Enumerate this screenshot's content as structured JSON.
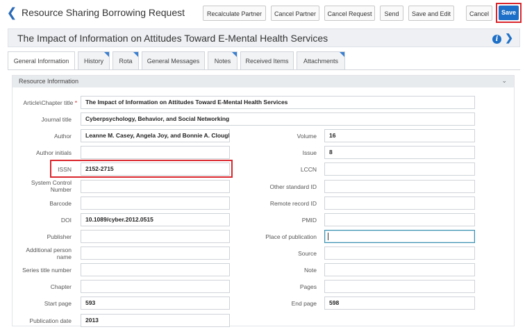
{
  "header": {
    "title": "Resource Sharing Borrowing Request",
    "buttons": [
      "Recalculate Partner",
      "Cancel Partner",
      "Cancel Request",
      "Send",
      "Save and Edit",
      "Cancel"
    ],
    "save_label": "Save"
  },
  "record": {
    "title": "The Impact of Information on Attitudes Toward E-Mental Health Services",
    "info": "i"
  },
  "tabs": [
    "General Information",
    "History",
    "Rota",
    "General Messages",
    "Notes",
    "Received Items",
    "Attachments"
  ],
  "section": {
    "title": "Resource Information"
  },
  "fields": {
    "article_title": {
      "label": "Article\\Chapter title",
      "req": "*",
      "value": "The Impact of Information on Attitudes Toward E-Mental Health Services"
    },
    "journal_title": {
      "label": "Journal title",
      "value": "Cyberpsychology, Behavior, and Social Networking"
    },
    "author": {
      "label": "Author",
      "value": "Leanne M. Casey, Angela Joy, and Bonnie A. Clough"
    },
    "author_initials": {
      "label": "Author initials",
      "value": ""
    },
    "issn": {
      "label": "ISSN",
      "value": "2152-2715"
    },
    "system_control_number": {
      "label": "System Control Number",
      "value": ""
    },
    "barcode": {
      "label": "Barcode",
      "value": ""
    },
    "doi": {
      "label": "DOI",
      "value": "10.1089/cyber.2012.0515"
    },
    "publisher": {
      "label": "Publisher",
      "value": ""
    },
    "additional_person_name": {
      "label": "Additional person name",
      "value": ""
    },
    "series_title_number": {
      "label": "Series title number",
      "value": ""
    },
    "chapter": {
      "label": "Chapter",
      "value": ""
    },
    "start_page": {
      "label": "Start page",
      "value": "593"
    },
    "publication_date": {
      "label": "Publication date",
      "value": "2013"
    },
    "volume": {
      "label": "Volume",
      "value": "16"
    },
    "issue": {
      "label": "Issue",
      "value": "8"
    },
    "lccn": {
      "label": "LCCN",
      "value": ""
    },
    "other_standard_id": {
      "label": "Other standard ID",
      "value": ""
    },
    "remote_record_id": {
      "label": "Remote record ID",
      "value": ""
    },
    "pmid": {
      "label": "PMID",
      "value": ""
    },
    "place_of_publication": {
      "label": "Place of publication",
      "value": ""
    },
    "source": {
      "label": "Source",
      "value": ""
    },
    "note": {
      "label": "Note",
      "value": ""
    },
    "pages": {
      "label": "Pages",
      "value": ""
    },
    "end_page": {
      "label": "End page",
      "value": "598"
    }
  },
  "colors": {
    "accent": "#1d6fc7",
    "highlight": "#d9262c",
    "focus": "#3a8fb0"
  },
  "icons": {
    "back": "chevron-left-icon",
    "info": "info-icon",
    "expand": "chevron-right-icon",
    "collapse": "chevron-down-icon"
  }
}
